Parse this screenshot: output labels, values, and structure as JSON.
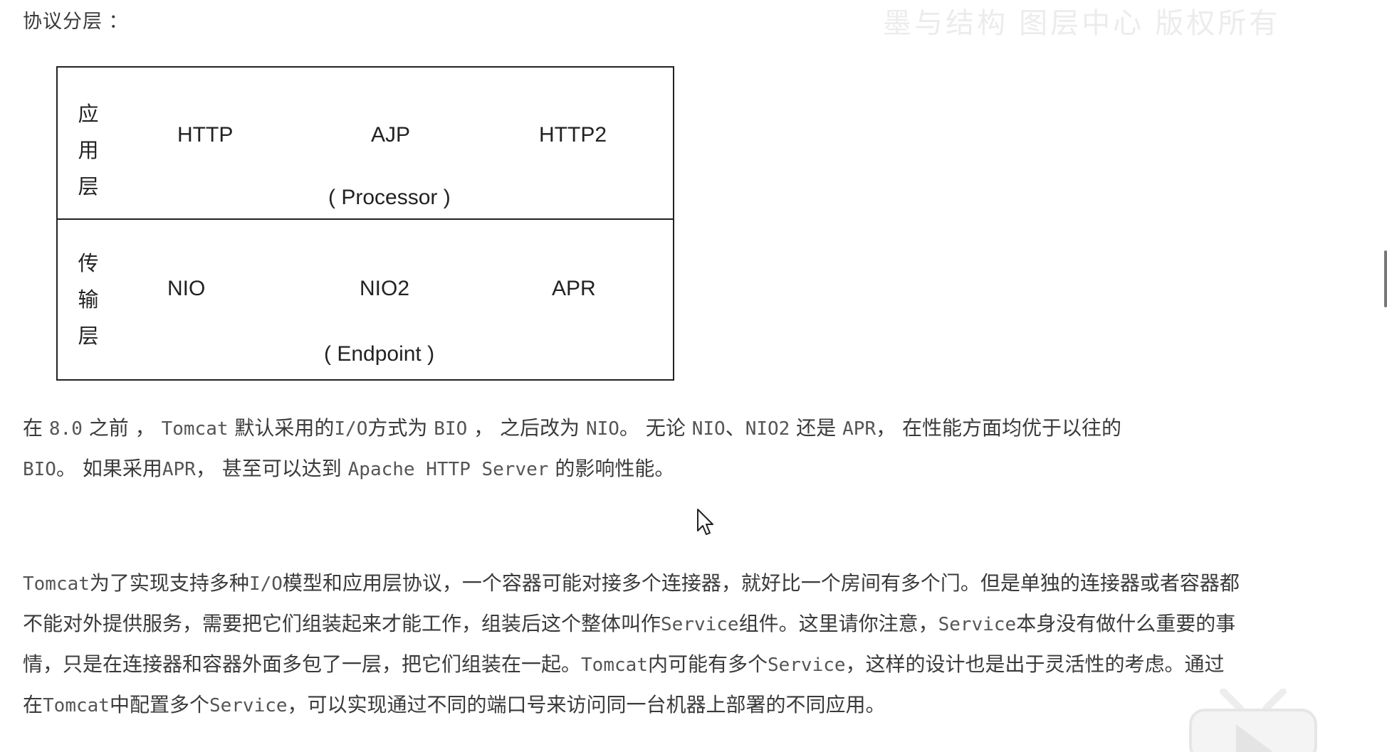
{
  "heading": "协议分层 ：",
  "watermark": "墨与结构 图层中心 版权所有",
  "table": {
    "application_layer": {
      "label_chars": [
        "应",
        "用",
        "层"
      ],
      "protocols": [
        "HTTP",
        "AJP",
        "HTTP2"
      ],
      "component": "( Processor )"
    },
    "transport_layer": {
      "label_chars": [
        "传",
        "输",
        "层"
      ],
      "protocols": [
        "NIO",
        "NIO2",
        "APR"
      ],
      "component": "( Endpoint )"
    }
  },
  "paragraph1": {
    "line1": [
      "在 ",
      "8.0",
      " 之前 ， ",
      "Tomcat",
      " 默认采用的",
      "I/O",
      "方式为 ",
      "BIO",
      " ， 之后改为 ",
      "NIO",
      "。 无论 ",
      "NIO",
      "、",
      "NIO2",
      " 还是 ",
      "APR",
      "， 在性能方面均优于以往的"
    ],
    "line2": [
      "BIO",
      "。 如果采用",
      "APR",
      "， 甚至可以达到 ",
      "Apache HTTP Server",
      " 的影响性能。"
    ]
  },
  "paragraph2": {
    "line1": [
      "Tomcat",
      "为了实现支持多种",
      "I/O",
      "模型和应用层协议，一个容器可能对接多个连接器，就好比一个房间有多个门。但是单独的连接器或者容器都"
    ],
    "line2": [
      "不能对外提供服务，需要把它们组装起来才能工作，组装后这个整体叫作",
      "Service",
      "组件。这里请你注意，",
      "Service",
      "本身没有做什么重要的事"
    ],
    "line3": [
      "情，只是在连接器和容器外面多包了一层，把它们组装在一起。",
      "Tomcat",
      "内可能有多个",
      "Service",
      "，这样的设计也是出于灵活性的考虑。通过"
    ],
    "line4": [
      "在",
      "Tomcat",
      "中配置多个",
      "Service",
      "，可以实现通过不同的端口号来访问同一台机器上部署的不同应用。"
    ]
  },
  "icons": {
    "cursor": "mouse-pointer-icon",
    "player": "tv-player-icon"
  }
}
